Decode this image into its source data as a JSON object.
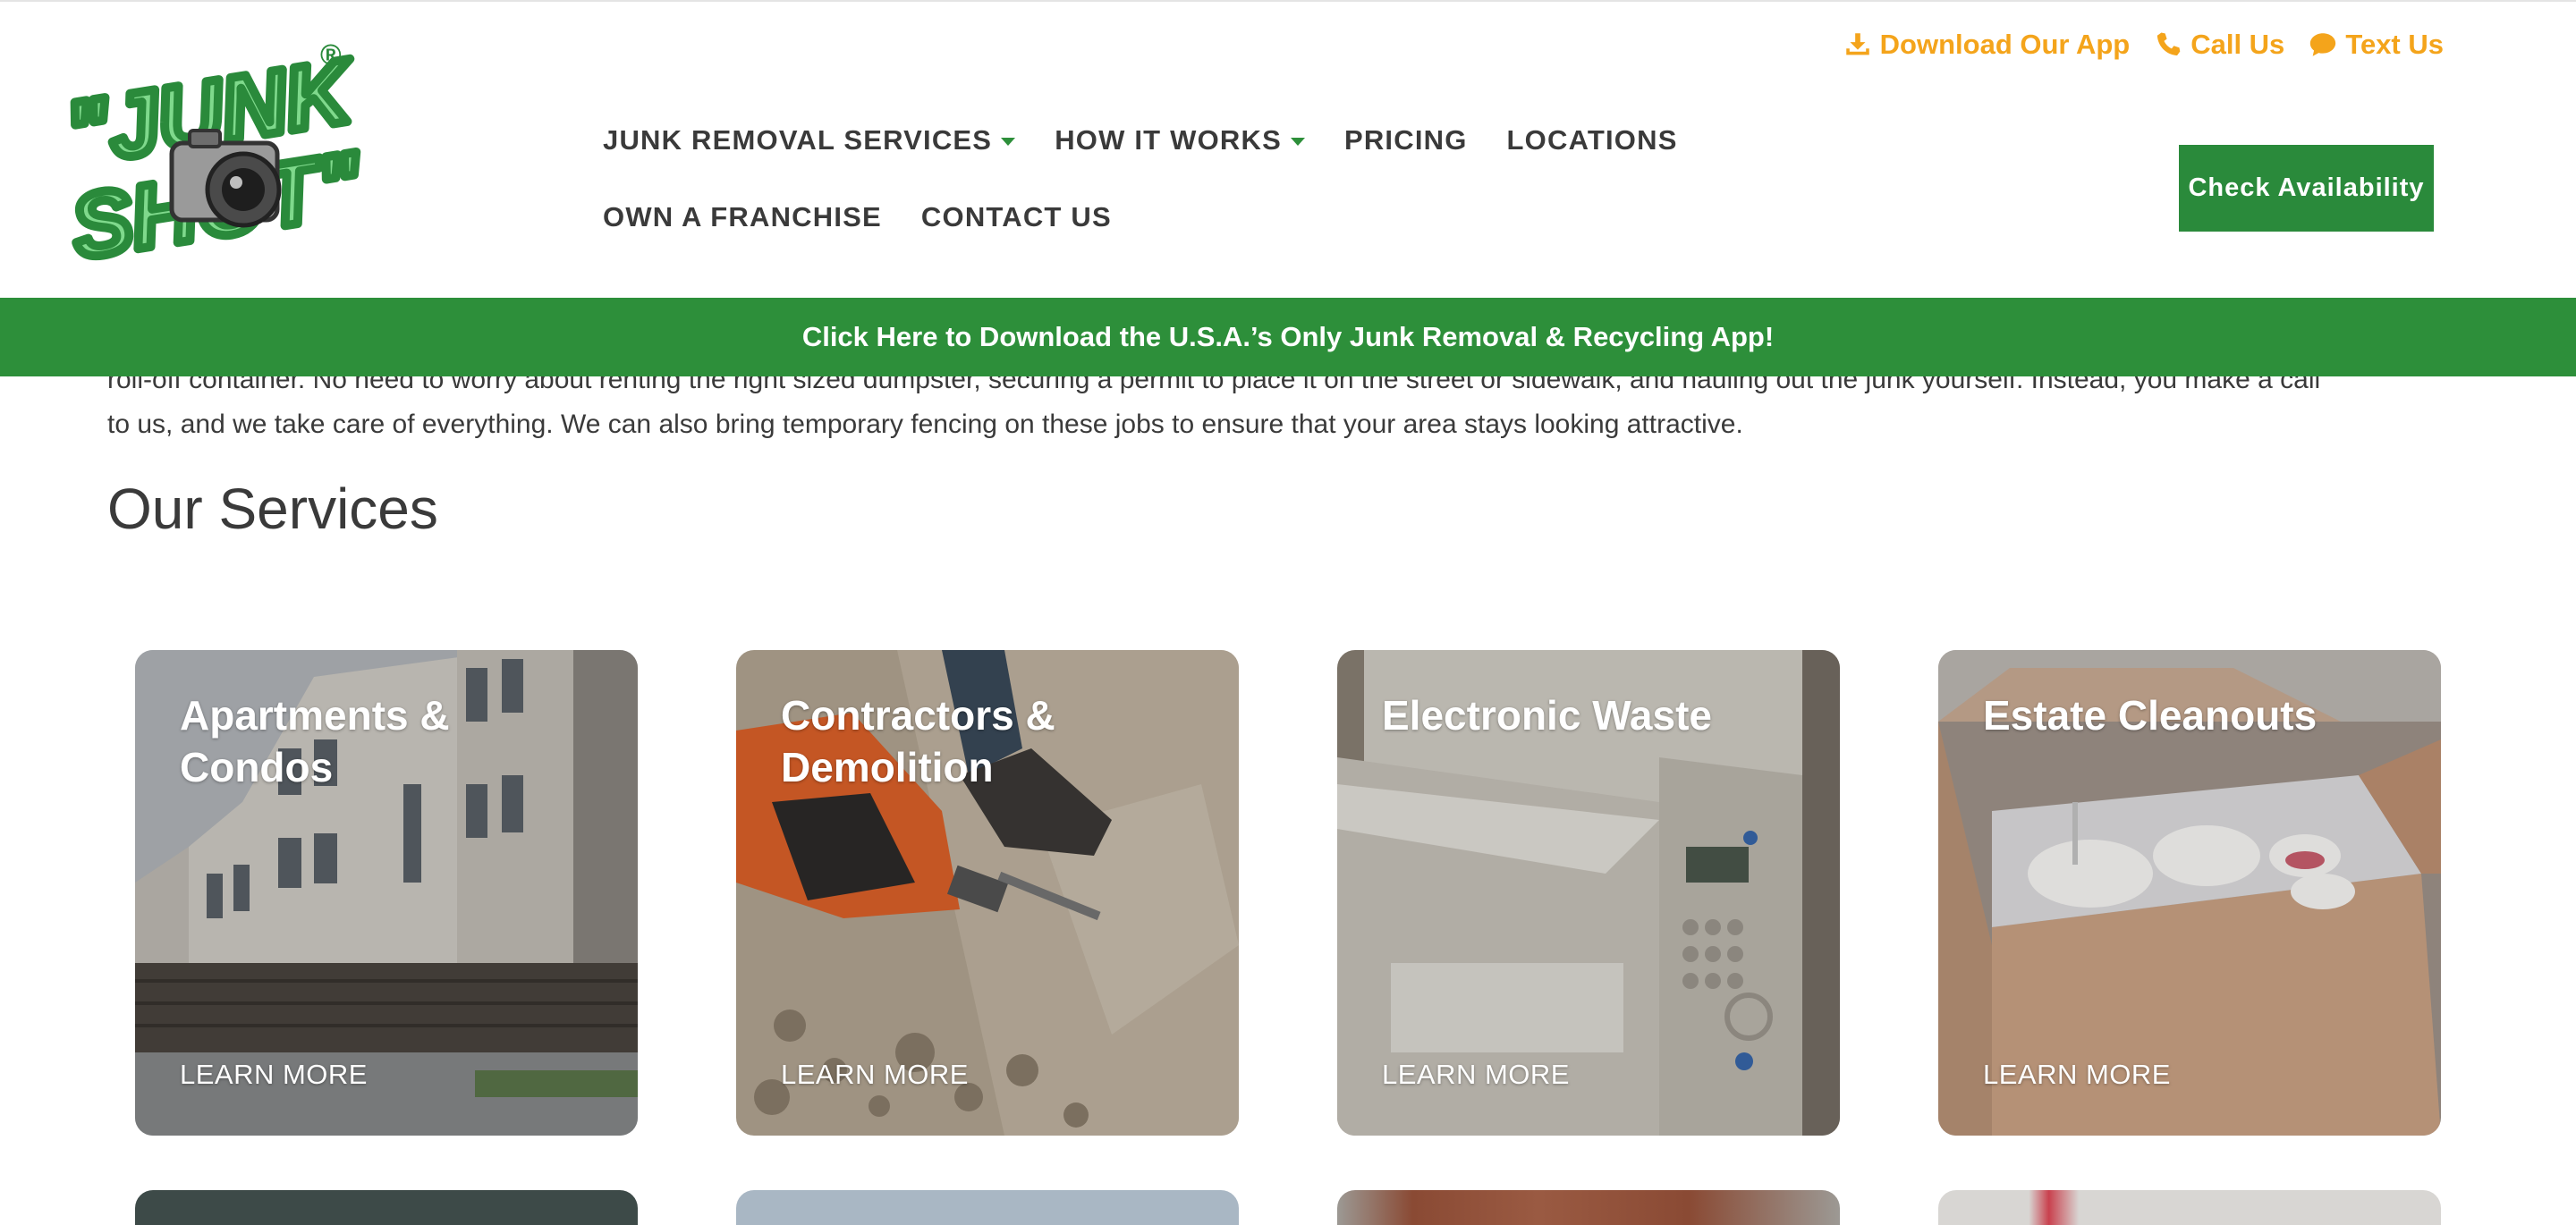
{
  "topbar": {
    "download_label": "Download Our App",
    "call_label": "Call Us",
    "text_label": "Text Us"
  },
  "brand": {
    "logo_text_line1": "\"JUNK",
    "logo_text_line2": "SHOT\"",
    "registered_mark": "®",
    "green": "#2a8a3b",
    "orange": "#f4a41b"
  },
  "nav": {
    "items": [
      {
        "label": "JUNK REMOVAL SERVICES",
        "has_dropdown": true
      },
      {
        "label": "HOW IT WORKS",
        "has_dropdown": true
      },
      {
        "label": "PRICING",
        "has_dropdown": false
      },
      {
        "label": "LOCATIONS",
        "has_dropdown": false
      },
      {
        "label": "OWN A FRANCHISE",
        "has_dropdown": false
      },
      {
        "label": "CONTACT US",
        "has_dropdown": false
      }
    ],
    "cta_label": "Check Availability"
  },
  "banner": {
    "text": "Click Here to Download the U.S.A.’s Only Junk Removal & Recycling App!"
  },
  "intro": {
    "line1": "roll-off container. No need to worry about renting the right sized dumpster, securing a permit to place it on the street or sidewalk, and hauling out the junk yourself. Instead, you make a call",
    "line2": "to us, and we take care of everything. We can also bring temporary fencing on these jobs to ensure that your area stays looking attractive."
  },
  "services": {
    "title": "Our Services",
    "cards": [
      {
        "title": "Apartments & Condos",
        "link": "LEARN MORE"
      },
      {
        "title": "Contractors & Demolition",
        "link": "LEARN MORE"
      },
      {
        "title": "Electronic Waste",
        "link": "LEARN MORE"
      },
      {
        "title": "Estate Cleanouts",
        "link": "LEARN MORE"
      }
    ]
  }
}
